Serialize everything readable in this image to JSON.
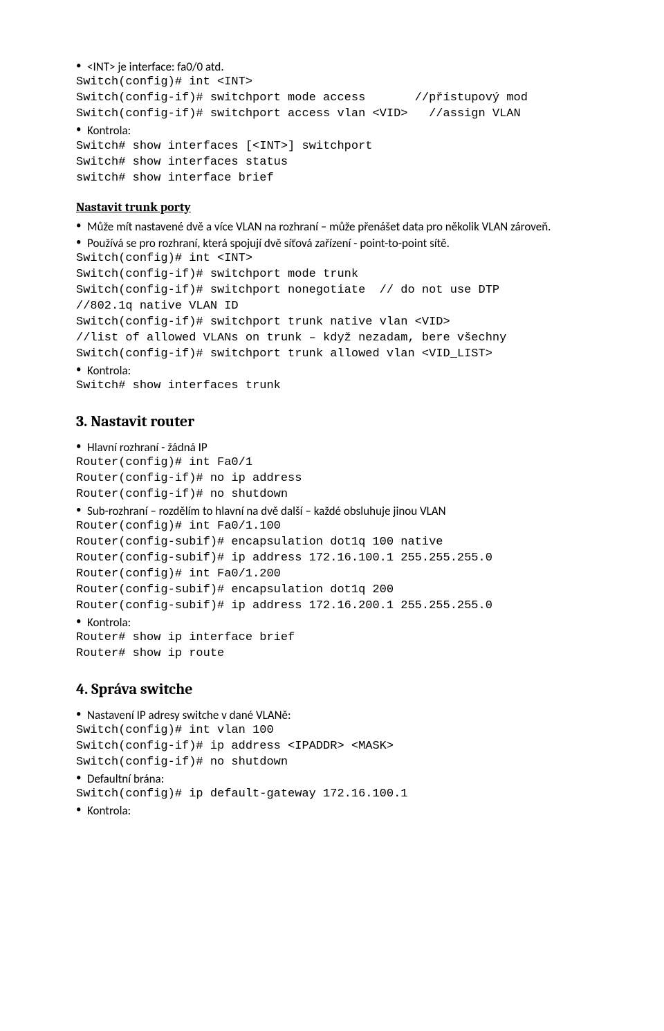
{
  "bullet1": "<INT> je interface: fa0/0 atd.",
  "cmd1a": "Switch(config)# int <INT>",
  "cmd1b": "Switch(config-if)# switchport mode access       //přístupový mod",
  "cmd1c": "Switch(config-if)# switchport access vlan <VID>   //assign VLAN",
  "kontrola": "Kontrola:",
  "cmd1d": "Switch# show interfaces [<INT>] switchport",
  "cmd1e": "Switch# show interfaces status",
  "cmd1f": "switch# show interface brief",
  "h_trunk": "Nastavit trunk porty",
  "bullet_trunk1": "Může mít nastavené dvě a více VLAN na rozhraní – může přenášet data pro několik VLAN zároveň.",
  "bullet_trunk2": "Používá se pro rozhraní, která spojují dvě síťová zařízení - point-to-point sítě.",
  "cmd2a": "Switch(config)# int <INT>",
  "cmd2b": "Switch(config-if)# switchport mode trunk",
  "cmd2c": "Switch(config-if)# switchport nonegotiate  // do not use DTP",
  "cmd2d": "//802.1q native VLAN ID",
  "cmd2e": "Switch(config-if)# switchport trunk native vlan <VID>",
  "cmd2f": "//list of allowed VLANs on trunk – když nezadam, bere všechny",
  "cmd2g": "Switch(config-if)# switchport trunk allowed vlan <VID_LIST>",
  "cmd2h": "Switch# show interfaces trunk",
  "h_router": "3. Nastavit router",
  "bullet_r1": "Hlavní rozhraní  - žádná IP",
  "cmd3a": "Router(config)# int Fa0/1",
  "cmd3b": "Router(config-if)# no ip address",
  "cmd3c": "Router(config-if)# no shutdown",
  "bullet_r2": "Sub-rozhraní – rozdělím to hlavní na dvě další – každé obsluhuje jinou VLAN",
  "cmd3d": "Router(config)# int Fa0/1.100",
  "cmd3e": "Router(config-subif)# encapsulation dot1q 100 native",
  "cmd3f": "Router(config-subif)# ip address 172.16.100.1 255.255.255.0",
  "cmd3g": "Router(config)# int Fa0/1.200",
  "cmd3h": "Router(config-subif)# encapsulation dot1q 200",
  "cmd3i": "Router(config-subif)# ip address 172.16.200.1 255.255.255.0",
  "cmd3j": "Router# show ip interface brief",
  "cmd3k": "Router# show ip route",
  "h_switch": "4. Správa switche",
  "bullet_s1": "Nastavení IP adresy switche v dané VLANě:",
  "cmd4a": "Switch(config)# int vlan 100",
  "cmd4b": "Switch(config-if)# ip address <IPADDR> <MASK>",
  "cmd4c": "Switch(config-if)# no shutdown",
  "bullet_s2": "Defaultní brána:",
  "cmd4d": "Switch(config)# ip default-gateway 172.16.100.1"
}
